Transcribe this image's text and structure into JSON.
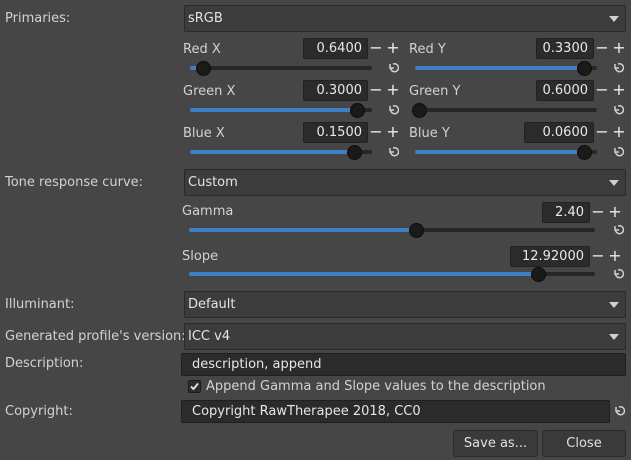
{
  "labels": {
    "primaries": "Primaries:",
    "trc": "Tone response curve:",
    "illuminant": "Illuminant:",
    "version": "Generated profile's version:",
    "description": "Description:",
    "copyright": "Copyright:"
  },
  "primaries_value": "sRGB",
  "primaries_params": [
    {
      "label": "Red X",
      "value": "0.6400",
      "level": 0.07
    },
    {
      "label": "Red Y",
      "value": "0.3300",
      "level": 0.93
    },
    {
      "label": "Green X",
      "value": "0.3000",
      "level": 0.92
    },
    {
      "label": "Green Y",
      "value": "0.6000",
      "level": 0.02
    },
    {
      "label": "Blue X",
      "value": "0.1500",
      "level": 0.9
    },
    {
      "label": "Blue Y",
      "value": "0.0600",
      "level": 0.93
    }
  ],
  "trc_value": "Custom",
  "gamma": {
    "label": "Gamma",
    "value": "2.40",
    "level": 0.56
  },
  "slope": {
    "label": "Slope",
    "value": "12.92000",
    "level": 0.86
  },
  "illuminant_value": "Default",
  "version_value": "ICC v4",
  "description_value": "description, append",
  "append_checkbox": {
    "label": "Append Gamma and Slope values to the description",
    "checked": true
  },
  "copyright_value": "Copyright RawTherapee 2018, CC0",
  "buttons": {
    "save": "Save as...",
    "close": "Close"
  },
  "colors": {
    "accent": "#3f7fc4",
    "background": "#464646"
  }
}
